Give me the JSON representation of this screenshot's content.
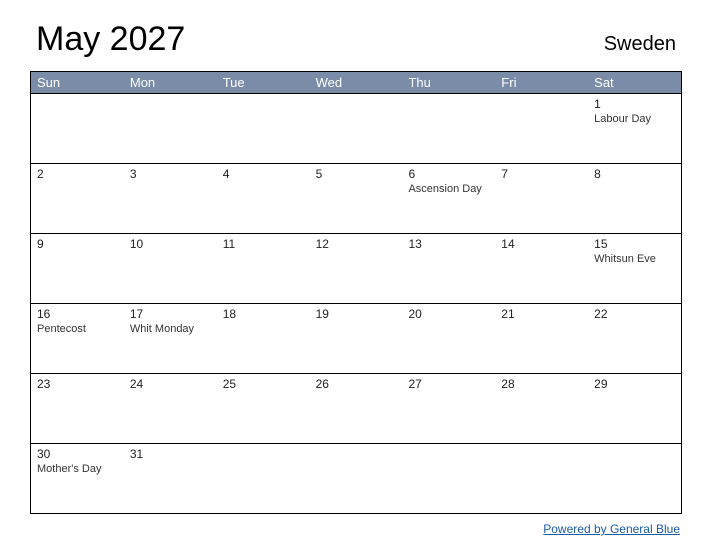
{
  "header": {
    "title": "May 2027",
    "region": "Sweden"
  },
  "weekdays": [
    "Sun",
    "Mon",
    "Tue",
    "Wed",
    "Thu",
    "Fri",
    "Sat"
  ],
  "weeks": [
    [
      {
        "num": "",
        "event": ""
      },
      {
        "num": "",
        "event": ""
      },
      {
        "num": "",
        "event": ""
      },
      {
        "num": "",
        "event": ""
      },
      {
        "num": "",
        "event": ""
      },
      {
        "num": "",
        "event": ""
      },
      {
        "num": "1",
        "event": "Labour Day"
      }
    ],
    [
      {
        "num": "2",
        "event": ""
      },
      {
        "num": "3",
        "event": ""
      },
      {
        "num": "4",
        "event": ""
      },
      {
        "num": "5",
        "event": ""
      },
      {
        "num": "6",
        "event": "Ascension Day"
      },
      {
        "num": "7",
        "event": ""
      },
      {
        "num": "8",
        "event": ""
      }
    ],
    [
      {
        "num": "9",
        "event": ""
      },
      {
        "num": "10",
        "event": ""
      },
      {
        "num": "11",
        "event": ""
      },
      {
        "num": "12",
        "event": ""
      },
      {
        "num": "13",
        "event": ""
      },
      {
        "num": "14",
        "event": ""
      },
      {
        "num": "15",
        "event": "Whitsun Eve"
      }
    ],
    [
      {
        "num": "16",
        "event": "Pentecost"
      },
      {
        "num": "17",
        "event": "Whit Monday"
      },
      {
        "num": "18",
        "event": ""
      },
      {
        "num": "19",
        "event": ""
      },
      {
        "num": "20",
        "event": ""
      },
      {
        "num": "21",
        "event": ""
      },
      {
        "num": "22",
        "event": ""
      }
    ],
    [
      {
        "num": "23",
        "event": ""
      },
      {
        "num": "24",
        "event": ""
      },
      {
        "num": "25",
        "event": ""
      },
      {
        "num": "26",
        "event": ""
      },
      {
        "num": "27",
        "event": ""
      },
      {
        "num": "28",
        "event": ""
      },
      {
        "num": "29",
        "event": ""
      }
    ],
    [
      {
        "num": "30",
        "event": "Mother's Day"
      },
      {
        "num": "31",
        "event": ""
      },
      {
        "num": "",
        "event": ""
      },
      {
        "num": "",
        "event": ""
      },
      {
        "num": "",
        "event": ""
      },
      {
        "num": "",
        "event": ""
      },
      {
        "num": "",
        "event": ""
      }
    ]
  ],
  "footer": {
    "link_text": "Powered by General Blue"
  }
}
